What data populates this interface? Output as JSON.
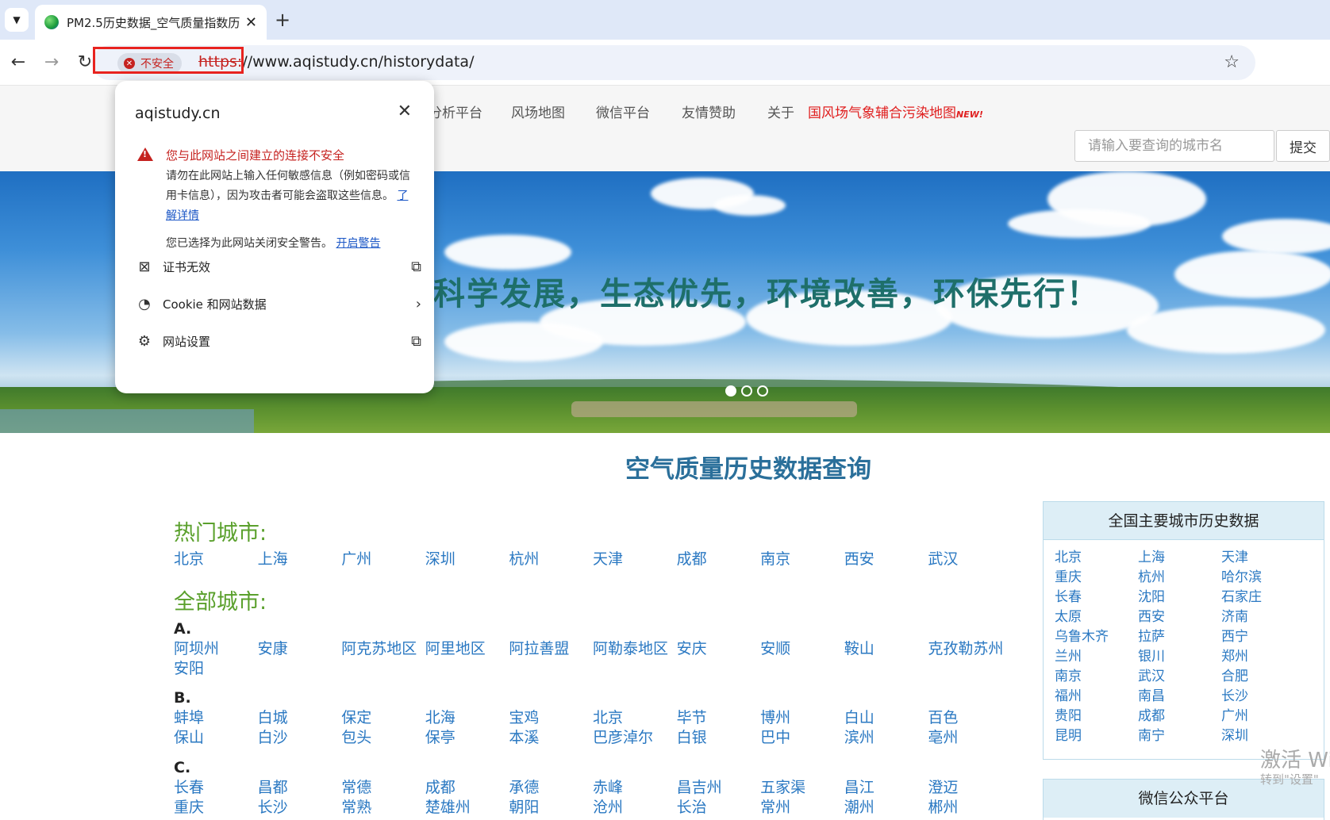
{
  "browser": {
    "tab_title": "PM2.5历史数据_空气质量指数历",
    "tab_close": "✕",
    "new_tab": "+",
    "security_chip": "不安全",
    "url_protocol": "https:",
    "url_rest": "//www.aqistudy.cn/historydata/"
  },
  "nav": {
    "items": [
      "分析平台",
      "风场地图",
      "微信平台",
      "友情赞助",
      "关于"
    ],
    "featured": "国风场气象辅合污染地图",
    "featured_badge": "NEW!",
    "search_placeholder": "请输入要查询的城市名",
    "submit_label": "提交"
  },
  "banner": {
    "slogan": "科学发展，生态优先，环境改善，环保先行！"
  },
  "main": {
    "title": "空气质量历史数据查询",
    "hot_heading": "热门城市:",
    "hot_cities": [
      "北京",
      "上海",
      "广州",
      "深圳",
      "杭州",
      "天津",
      "成都",
      "南京",
      "西安",
      "武汉"
    ],
    "all_heading": "全部城市:",
    "groups": [
      {
        "letter": "A.",
        "cities": [
          "阿坝州",
          "安康",
          "阿克苏地区",
          "阿里地区",
          "阿拉善盟",
          "阿勒泰地区",
          "安庆",
          "安顺",
          "鞍山",
          "克孜勒苏州",
          "安阳"
        ]
      },
      {
        "letter": "B.",
        "cities": [
          "蚌埠",
          "白城",
          "保定",
          "北海",
          "宝鸡",
          "北京",
          "毕节",
          "博州",
          "白山",
          "百色",
          "保山",
          "白沙",
          "包头",
          "保亭",
          "本溪",
          "巴彦淖尔",
          "白银",
          "巴中",
          "滨州",
          "亳州"
        ]
      },
      {
        "letter": "C.",
        "cities": [
          "长春",
          "昌都",
          "常德",
          "成都",
          "承德",
          "赤峰",
          "昌吉州",
          "五家渠",
          "昌江",
          "澄迈",
          "重庆",
          "长沙",
          "常熟",
          "楚雄州",
          "朝阳",
          "沧州",
          "长治",
          "常州",
          "潮州",
          "郴州"
        ]
      }
    ]
  },
  "side_panel": {
    "title": "全国主要城市历史数据",
    "cities": [
      "北京",
      "上海",
      "天津",
      "重庆",
      "杭州",
      "哈尔滨",
      "长春",
      "沈阳",
      "石家庄",
      "太原",
      "西安",
      "济南",
      "乌鲁木齐",
      "拉萨",
      "西宁",
      "兰州",
      "银川",
      "郑州",
      "南京",
      "武汉",
      "合肥",
      "福州",
      "南昌",
      "长沙",
      "贵阳",
      "成都",
      "广州",
      "昆明",
      "南宁",
      "深圳"
    ],
    "wechat_title": "微信公众平台"
  },
  "watermark": {
    "line1": "激活 Wi",
    "line2": "转到\"设置\""
  },
  "popup": {
    "domain": "aqistudy.cn",
    "warning_title": "您与此网站之间建立的连接不安全",
    "warning_body": "请勿在此网站上输入任何敏感信息（例如密码或信用卡信息），因为攻击者可能会盗取这些信息。",
    "learn_more": "了解详情",
    "warning_note": "您已选择为此网站关闭安全警告。",
    "enable_warning": "开启警告",
    "rows": [
      "证书无效",
      "Cookie 和网站数据",
      "网站设置"
    ]
  }
}
